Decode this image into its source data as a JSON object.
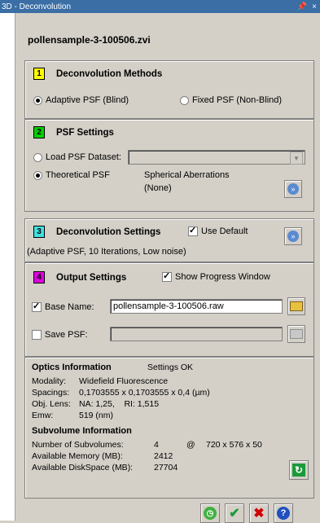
{
  "window": {
    "title": "3D - Deconvolution",
    "pin": "ᵠ",
    "close": "×"
  },
  "file_name": "pollensample-3-100506.zvi",
  "methods": {
    "number": "1",
    "title": "Deconvolution Methods",
    "option_adaptive": "Adaptive PSF (Blind)",
    "option_fixed": "Fixed PSF (Non-Blind)",
    "selected": "adaptive"
  },
  "psf": {
    "number": "2",
    "title": "PSF Settings",
    "load_label": "Load PSF Dataset:",
    "load_value": "",
    "theoretical_label": "Theoretical PSF",
    "spherical_label": "Spherical Aberrations",
    "spherical_value": "(None)"
  },
  "deconv_settings": {
    "number": "3",
    "title": "Deconvolution Settings",
    "use_default_label": "Use Default",
    "summary": "(Adaptive PSF, 10 Iterations, Low noise)"
  },
  "output": {
    "number": "4",
    "title": "Output Settings",
    "show_progress_label": "Show Progress Window",
    "base_name_label": "Base Name:",
    "base_name_value": "pollensample-3-100506.raw",
    "save_psf_label": "Save PSF:",
    "save_psf_value": ""
  },
  "optics": {
    "title": "Optics Information",
    "status": "Settings OK",
    "rows": [
      {
        "label": "Modality:",
        "value": "Widefield Fluorescence"
      },
      {
        "label": "Spacings:",
        "value": "0,1703555 x 0,1703555 x 0,4 (µm)"
      },
      {
        "label": "Obj. Lens:",
        "value": "NA: 1,25,    RI: 1,515"
      },
      {
        "label": "Emw:",
        "value": "519 (nm)"
      }
    ]
  },
  "subvolume": {
    "title": "Subvolume Information",
    "num_label": "Number of Subvolumes:",
    "num_value": "4",
    "at": "@",
    "dims": "720 x 576 x 50",
    "mem_label": "Available Memory (MB):",
    "mem_value": "2412",
    "disk_label": "Available DiskSpace (MB):",
    "disk_value": "27704"
  },
  "colors": {
    "num1": "#ffff00",
    "num2": "#00d000",
    "num3": "#40e0e0",
    "num4": "#e000e0",
    "title_bg": "#3a6ea5"
  }
}
